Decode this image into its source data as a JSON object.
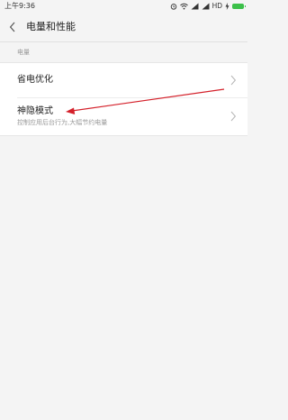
{
  "status_bar": {
    "time": "上午9:36",
    "network_label": "HD",
    "icons": [
      "alarm-icon",
      "wifi-icon",
      "signal-icon",
      "signal-icon",
      "charging-icon",
      "battery-icon"
    ]
  },
  "header": {
    "back_icon": "chevron-left-icon",
    "title": "电量和性能"
  },
  "section": {
    "label": "电量"
  },
  "items": [
    {
      "title": "省电优化",
      "subtitle": ""
    },
    {
      "title": "神隐模式",
      "subtitle": "控制应用后台行为,大幅节约电量"
    }
  ],
  "colors": {
    "background": "#f4f4f4",
    "card": "#ffffff",
    "annotation_arrow": "#d4202a",
    "battery": "#3cc04a"
  }
}
